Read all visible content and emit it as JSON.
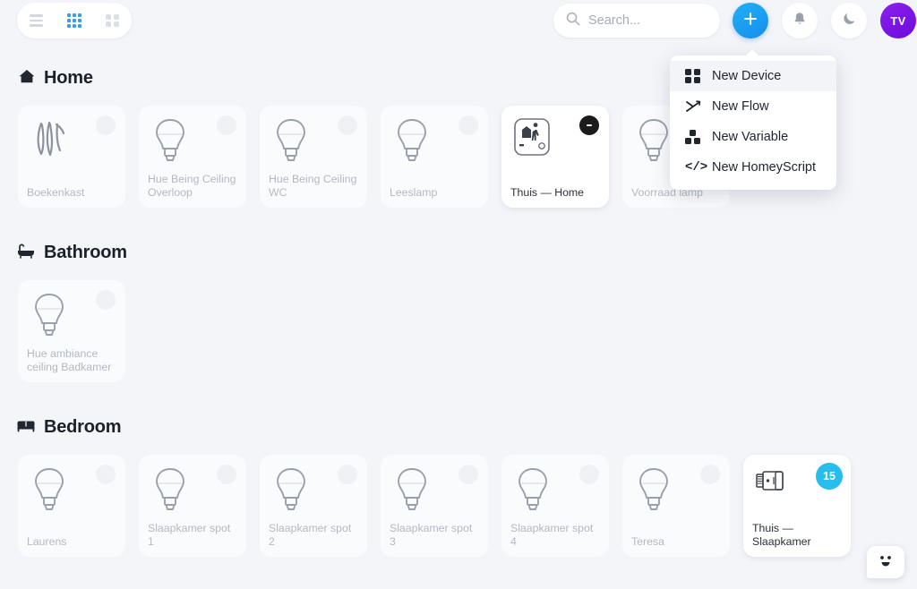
{
  "topbar": {
    "view_toggle": [
      {
        "name": "list-view",
        "icon": "list-icon",
        "active": false
      },
      {
        "name": "grid-large-view",
        "icon": "grid-9-icon",
        "active": true
      },
      {
        "name": "grid-small-view",
        "icon": "grid-4-icon",
        "active": false
      }
    ],
    "search": {
      "placeholder": "Search...",
      "value": "",
      "icon": "search-icon"
    },
    "add_button": {
      "icon": "plus-icon",
      "label": "+"
    },
    "notifications_button": {
      "icon": "bell-icon"
    },
    "dark_mode_button": {
      "icon": "moon-icon"
    },
    "avatar": {
      "initials": "TV"
    },
    "accent_blue": "#168df0",
    "avatar_purple": "#6b0ce0"
  },
  "dropdown": {
    "items": [
      {
        "label": "New Device",
        "icon": "grid-4-icon",
        "active": true
      },
      {
        "label": "New Flow",
        "icon": "flow-arrows-icon",
        "active": false
      },
      {
        "label": "New Variable",
        "icon": "variable-blocks-icon",
        "active": false
      },
      {
        "label": "New HomeyScript",
        "icon": "code-icon",
        "active": false
      }
    ]
  },
  "sections": [
    {
      "title": "Home",
      "icon": "house-icon",
      "devices": [
        {
          "label": "Boekenkast",
          "icon": "ribbon-icon",
          "state": "off",
          "badge": null
        },
        {
          "label": "Hue Being Ceiling Overloop",
          "icon": "bulb-icon",
          "state": "off",
          "badge": null
        },
        {
          "label": "Hue Being Ceiling WC",
          "icon": "bulb-icon",
          "state": "off",
          "badge": null
        },
        {
          "label": "Leeslamp",
          "icon": "bulb-icon",
          "state": "off",
          "badge": null
        },
        {
          "label": "Thuis — Home",
          "icon": "presence-icon",
          "state": "on",
          "badge": "dark"
        },
        {
          "label": "Voorraad lamp",
          "icon": "bulb-icon",
          "state": "off",
          "badge": null
        }
      ]
    },
    {
      "title": "Bathroom",
      "icon": "bathtub-icon",
      "devices": [
        {
          "label": "Hue ambiance ceiling Badkamer",
          "icon": "bulb-icon",
          "state": "off",
          "badge": null
        }
      ]
    },
    {
      "title": "Bedroom",
      "icon": "bed-icon",
      "devices": [
        {
          "label": "Laurens",
          "icon": "bulb-icon",
          "state": "off",
          "badge": null
        },
        {
          "label": "Slaapkamer spot 1",
          "icon": "bulb-icon",
          "state": "off",
          "badge": null
        },
        {
          "label": "Slaapkamer spot 2",
          "icon": "bulb-icon",
          "state": "off",
          "badge": null
        },
        {
          "label": "Slaapkamer spot 3",
          "icon": "bulb-icon",
          "state": "off",
          "badge": null
        },
        {
          "label": "Slaapkamer spot 4",
          "icon": "bulb-icon",
          "state": "off",
          "badge": null
        },
        {
          "label": "Teresa",
          "icon": "bulb-icon",
          "state": "off",
          "badge": null
        },
        {
          "label": "Thuis — Slaapkamer",
          "icon": "thermostat-icon",
          "state": "on",
          "badge": "15"
        }
      ]
    }
  ],
  "chat_widget": {
    "icon": "smiley-face-icon"
  }
}
